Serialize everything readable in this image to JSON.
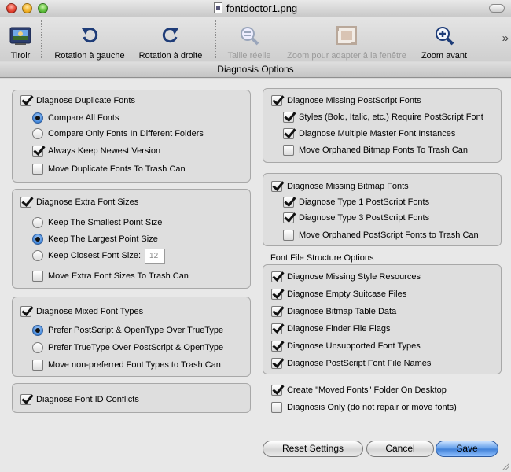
{
  "window": {
    "title": "fontdoctor1.png"
  },
  "toolbar": {
    "items": [
      {
        "label": "Tiroir",
        "icon": "drawer-icon",
        "enabled": true
      },
      {
        "label": "Rotation à gauche",
        "icon": "rotate-left-icon",
        "enabled": true
      },
      {
        "label": "Rotation à droite",
        "icon": "rotate-right-icon",
        "enabled": true
      },
      {
        "label": "Taille réelle",
        "icon": "actual-size-icon",
        "enabled": false
      },
      {
        "label": "Zoom pour adapter à la fenêtre",
        "icon": "zoom-to-fit-icon",
        "enabled": false
      },
      {
        "label": "Zoom avant",
        "icon": "zoom-in-icon",
        "enabled": true
      }
    ],
    "overflow": "»"
  },
  "sheet": {
    "title": "Diagnosis Options"
  },
  "duplicate": {
    "main": {
      "label": "Diagnose Duplicate Fonts",
      "checked": true
    },
    "options": [
      {
        "label": "Compare All Fonts",
        "selected": true
      },
      {
        "label": "Compare Only Fonts In Different Folders",
        "selected": false
      }
    ],
    "keep_newest": {
      "label": "Always Keep Newest Version",
      "checked": true
    },
    "move_trash": {
      "label": "Move Duplicate Fonts To Trash Can",
      "checked": false
    }
  },
  "extra_sizes": {
    "main": {
      "label": "Diagnose Extra Font Sizes",
      "checked": true
    },
    "options": [
      {
        "label": "Keep The Smallest Point Size",
        "selected": false
      },
      {
        "label": "Keep The Largest Point Size",
        "selected": true
      },
      {
        "label": "Keep Closest Font Size:",
        "selected": false
      }
    ],
    "closest_size_value": "12",
    "move_trash": {
      "label": "Move Extra Font Sizes To Trash Can",
      "checked": false
    }
  },
  "mixed_types": {
    "main": {
      "label": "Diagnose Mixed Font Types",
      "checked": true
    },
    "options": [
      {
        "label": "Prefer PostScript & OpenType Over TrueType",
        "selected": true
      },
      {
        "label": "Prefer TrueType Over PostScript & OpenType",
        "selected": false
      }
    ],
    "move_trash": {
      "label": "Move non-preferred Font Types to Trash Can",
      "checked": false
    }
  },
  "font_id": {
    "main": {
      "label": "Diagnose Font ID Conflicts",
      "checked": true
    }
  },
  "missing_ps": {
    "main": {
      "label": "Diagnose Missing PostScript Fonts",
      "checked": true
    },
    "styles": {
      "label": "Styles (Bold, Italic, etc.) Require PostScript Font",
      "checked": true
    },
    "multiple_master": {
      "label": "Diagnose Multiple Master Font Instances",
      "checked": true
    },
    "move_orphaned": {
      "label": "Move Orphaned Bitmap Fonts To Trash Can",
      "checked": false
    }
  },
  "missing_bitmap": {
    "main": {
      "label": "Diagnose Missing Bitmap Fonts",
      "checked": true
    },
    "type1": {
      "label": "Diagnose Type 1 PostScript Fonts",
      "checked": true
    },
    "type3": {
      "label": "Diagnose Type 3 PostScript Fonts",
      "checked": true
    },
    "move_orphaned": {
      "label": "Move Orphaned PostScript Fonts to Trash Can",
      "checked": false
    }
  },
  "structure": {
    "heading": "Font File Structure Options",
    "items": [
      {
        "label": "Diagnose Missing Style Resources",
        "checked": true
      },
      {
        "label": "Diagnose Empty Suitcase Files",
        "checked": true
      },
      {
        "label": "Diagnose Bitmap Table Data",
        "checked": true
      },
      {
        "label": "Diagnose Finder File Flags",
        "checked": true
      },
      {
        "label": "Diagnose Unsupported Font Types",
        "checked": true
      },
      {
        "label": "Diagnose PostScript Font File Names",
        "checked": true
      }
    ]
  },
  "extra": {
    "create_folder": {
      "label": "Create \"Moved Fonts\" Folder On Desktop",
      "checked": true
    },
    "diagnosis_only": {
      "label": "Diagnosis Only (do not repair or move fonts)",
      "checked": false
    }
  },
  "buttons": {
    "reset": "Reset Settings",
    "cancel": "Cancel",
    "save": "Save"
  },
  "colors": {
    "accent": "#3f7fd6",
    "title_bar": "#d4d4d4",
    "sheet_bg": "#e8e8e8"
  }
}
